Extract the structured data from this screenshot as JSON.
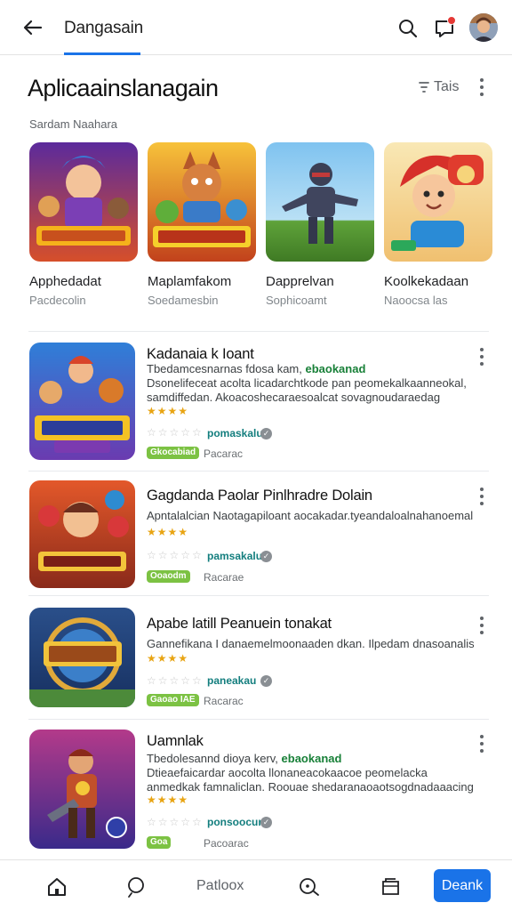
{
  "topbar": {
    "title": "Dangasain",
    "back_icon": "arrow-left-icon",
    "search_icon": "search-icon",
    "notification_icon": "notification-icon",
    "avatar_icon": "avatar"
  },
  "heading": {
    "title": "Aplicaainslanagain",
    "sort_label": "Tais",
    "sort_icon": "filter-icon"
  },
  "featured": {
    "section_label": "Sardam Naahara",
    "items": [
      {
        "name": "Apphedadat",
        "sub": "Pacdecolin",
        "art": "game-art-warriors"
      },
      {
        "name": "Maplamfakom",
        "sub": "Soedamesbin",
        "art": "game-art-fox-hero"
      },
      {
        "name": "Dapprelvan",
        "sub": "Sophicoamt",
        "art": "game-art-robot"
      },
      {
        "name": "Koolkekadaan",
        "sub": "Naoocsa las",
        "art": "game-art-redhair"
      }
    ]
  },
  "list": [
    {
      "title": "Kadanaia k Ioant",
      "desc1": "Tbedamcesnarnas fdosa kam, ",
      "desc1_hl": "ebaokanad",
      "desc2": "Dsonelifeceat acolta licadarchtkode pan peomekalkaanneokal, samdiffedan. Akoacoshecaraesoalcat sovagnoudaraedag",
      "stars": "★★★★",
      "stars_empty": "☆☆☆☆☆",
      "verified_label": "pomaskalu",
      "badge": "Gkocabiad",
      "meta": "Pacarac",
      "art": "game-art-squad"
    },
    {
      "title": "Gagdanda Paolar Pinlhradre Dolain",
      "desc1": "Apntalalcian Naotagapiloant aocakadar.tyeandaloalnahanoemal",
      "desc1_hl": "",
      "desc2": "",
      "stars": "★★★★",
      "stars_empty": "☆☆☆☆☆",
      "verified_label": "pamsakalu",
      "badge": "Ooaodm",
      "meta": "Racarae",
      "art": "game-art-boxer"
    },
    {
      "title": "Apabe latill Peanuein tonakat",
      "desc1": "Gannefikana I danaemelmoonaaden dkan. Ilpedam dnasoanalis",
      "desc1_hl": "",
      "desc2": "",
      "stars": "★★★★",
      "stars_empty": "☆☆☆☆☆",
      "verified_label": "paneakau",
      "badge": "Gaoao IAE",
      "meta": "Racarac",
      "art": "game-art-shield"
    },
    {
      "title": "Uamnlak",
      "desc1": "Tbedolesannd dioya kerv, ",
      "desc1_hl": "ebaokanad",
      "desc2": "Dtieaefaicardar aocolta llonaneacokaacoe peomelacka anmedkak famnaliclan. Roouae shedaranaoaotsogdnadaaacing",
      "stars": "★★★★",
      "stars_empty": "☆☆☆☆☆",
      "verified_label": "ponsoocun",
      "badge": "Goa",
      "meta": "Pacoarac",
      "art": "game-art-gunner"
    }
  ],
  "bottomnav": {
    "home_icon": "home-icon",
    "explore_icon": "explore-icon",
    "center_label": "Patloox",
    "search_icon": "search-icon",
    "library_icon": "library-icon",
    "cta_label": "Deank"
  },
  "colors": {
    "accent": "#1a73e8",
    "star": "#e8a413",
    "badge": "#7cc243",
    "verified": "#137e7e"
  }
}
